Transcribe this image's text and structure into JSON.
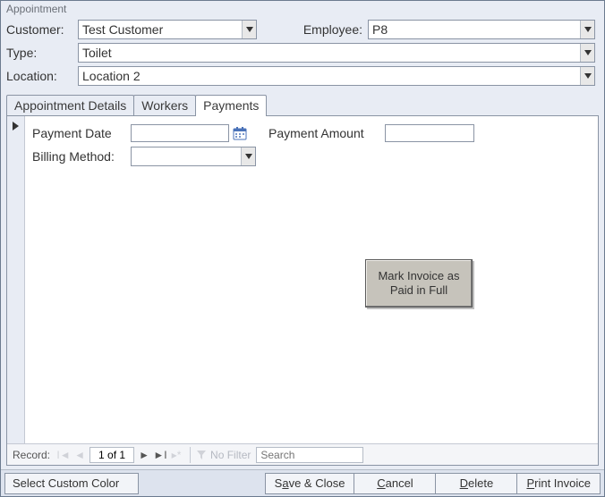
{
  "window": {
    "title": "Appointment"
  },
  "header": {
    "labels": {
      "customer": "Customer:",
      "employee": "Employee:",
      "type": "Type:",
      "location": "Location:"
    },
    "values": {
      "customer": "Test Customer",
      "employee": "P8",
      "type": "Toilet",
      "location": "Location 2"
    }
  },
  "tabs": [
    {
      "id": "details",
      "label": "Appointment Details",
      "active": false
    },
    {
      "id": "workers",
      "label": "Workers",
      "active": false
    },
    {
      "id": "payments",
      "label": "Payments",
      "active": true
    }
  ],
  "payments": {
    "labels": {
      "payment_date": "Payment Date",
      "payment_amount": "Payment Amount",
      "billing_method": "Billing Method:"
    },
    "values": {
      "payment_date": "",
      "payment_amount": "",
      "billing_method": ""
    },
    "mark_paid_button": "Mark Invoice as Paid in Full"
  },
  "record_nav": {
    "label": "Record:",
    "page": "1 of 1",
    "filter_text": "No Filter",
    "search_placeholder": "Search"
  },
  "footer": {
    "select_color": "Select Custom Color",
    "save_close_pre": "S",
    "save_close_u": "a",
    "save_close_post": "ve & Close",
    "cancel_u": "C",
    "cancel_post": "ancel",
    "delete_u": "D",
    "delete_post": "elete",
    "print_u": "P",
    "print_post": "rint Invoice"
  }
}
